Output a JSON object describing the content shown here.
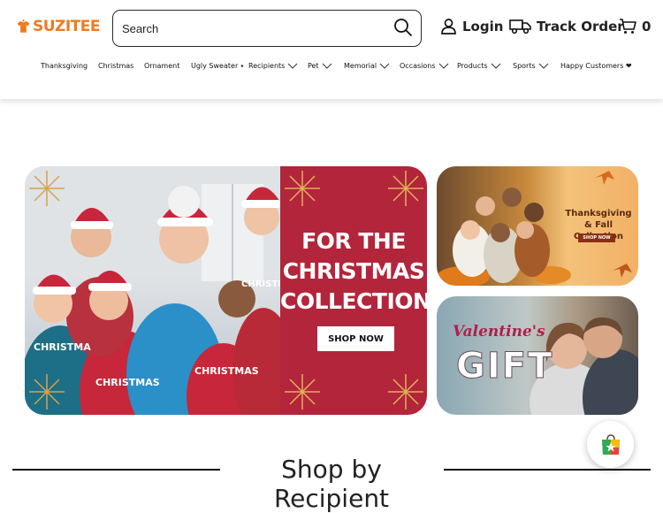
{
  "header": {
    "logo_text": "SUZITEE",
    "search": {
      "placeholder": "Search"
    },
    "login_label": "Login",
    "track_label": "Track Order",
    "cart_count": "0"
  },
  "nav": {
    "items": [
      {
        "label": "Thanksgiving",
        "has_dropdown": false
      },
      {
        "label": "Christmas",
        "has_dropdown": false
      },
      {
        "label": "Ornament",
        "has_dropdown": false
      },
      {
        "label": "Ugly Sweater ⭑",
        "has_dropdown": false
      },
      {
        "label": "Recipients",
        "has_dropdown": true
      },
      {
        "label": "Pet",
        "has_dropdown": true
      },
      {
        "label": "Memorial",
        "has_dropdown": true
      },
      {
        "label": "Occasions",
        "has_dropdown": true
      },
      {
        "label": "Products",
        "has_dropdown": true
      },
      {
        "label": "Sports",
        "has_dropdown": true
      },
      {
        "label": "Happy Customers ❤",
        "has_dropdown": false
      }
    ]
  },
  "banners": {
    "hero": {
      "title": "FOR THE CHRISTMAS COLLECTION",
      "button": "SHOP NOW",
      "accent": "#b3253b"
    },
    "thanksgiving": {
      "title": "Thanksgiving & Fall Collection",
      "button": "SHOP NOW"
    },
    "valentine": {
      "script": "Valentine's",
      "title": "GIFT"
    }
  },
  "section": {
    "title": "Shop by Recipient"
  },
  "colors": {
    "brand": "#f07a1e",
    "accent_red": "#b3253b"
  }
}
